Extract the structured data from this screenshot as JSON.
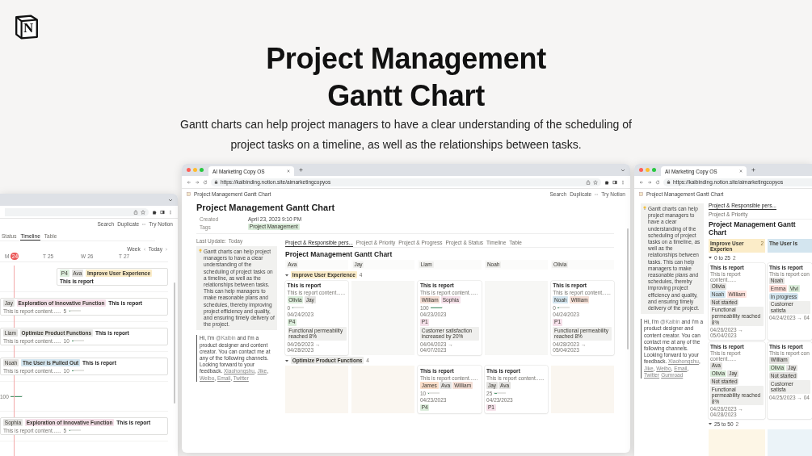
{
  "logo": "N",
  "title": "Project Management Gantt Chart",
  "description": "Gantt charts can help project managers to have a clear understanding of the scheduling of project tasks on a timeline, as well as the relationships between tasks.",
  "main_window": {
    "tab_title": "AI Marketing Copy OS",
    "url": "https://kaibinding.notion.site/aimarketingcopyos",
    "breadcrumb": "Project Management Gantt Chart",
    "actions": [
      "Search",
      "Duplicate",
      "Try Notion"
    ],
    "page_title": "Project Management Gantt Chart",
    "properties": [
      {
        "kind": "text",
        "label": "Created",
        "value": "April 23, 2023 9:10 PM"
      },
      {
        "kind": "tag",
        "label": "Tags",
        "value": "Project Management"
      }
    ],
    "last_update": {
      "label": "Last Update:",
      "value": "Today"
    },
    "callout": "Gantt charts can help project managers to have a clear understanding of the scheduling of project tasks on a timeline, as well as the relationships between tasks. This can help managers to make reasonable plans and schedules, thereby improving project efficiency and quality, and ensuring timely delivery of the project.",
    "quote": {
      "before": "Hi, I'm ",
      "mention": "@Kaibin",
      "after": " and I'm a product designer and content creator. You can contact me at any of the following channels. Looking forward to your feedback.",
      "channels": [
        {
          "name": "Xiaohongshu",
          "sep": ", "
        },
        {
          "name": "Jike",
          "sep": ", "
        },
        {
          "name": "Weibo",
          "sep": ", "
        },
        {
          "name": "Email",
          "sep": ", "
        },
        {
          "name": "Twitter"
        }
      ]
    },
    "views": [
      {
        "label": "Project & Responsible pers...",
        "selected": true
      },
      {
        "label": "Project & Priority",
        "selected": false
      },
      {
        "label": "Project & Progress",
        "selected": false
      },
      {
        "label": "Project & Status",
        "selected": false
      },
      {
        "label": "Timeline",
        "selected": false
      },
      {
        "label": "Table",
        "selected": false
      }
    ],
    "board_title": "Project Management Gantt Chart",
    "columns": [
      "Ava",
      "Jay",
      "Liam",
      "Noah",
      "Olivia"
    ],
    "groups": [
      {
        "name": "Improve User Experience",
        "count": "4",
        "color": "#fbecc8",
        "cards": [
          {
            "kind": "card",
            "title": "This is report",
            "content": "This is report content......",
            "people": [
              {
                "name": "Olivia",
                "color": "#dbeddb"
              },
              {
                "name": "Jay",
                "color": "#e3e2e0"
              }
            ],
            "progress": "0",
            "level": 0,
            "date": "04/24/2023",
            "priority": {
              "label": "P4",
              "color": "#dbeddb"
            },
            "goal": "Functional permeability reached 8%",
            "range": "04/26/2023 → 04/28/2023"
          },
          {
            "kind": "empty"
          },
          {
            "kind": "card",
            "title": "This is report",
            "content": "This is report content......",
            "people": [
              {
                "name": "William",
                "color": "#f4dfd6"
              },
              {
                "name": "Sophia",
                "color": "#f5e0e9"
              }
            ],
            "progress": "100",
            "level": 1,
            "date": "04/23/2023",
            "priority": {
              "label": "P1",
              "color": "#f5e0e9"
            },
            "goal": "Customer satisfaction increased by 20%",
            "range": "04/04/2023 → 04/07/2023"
          },
          {
            "kind": "empty"
          },
          {
            "kind": "card",
            "title": "This is report",
            "content": "This is report content......",
            "people": [
              {
                "name": "Noah",
                "color": "#d3e5ef"
              },
              {
                "name": "William",
                "color": "#f4dfd6"
              }
            ],
            "progress": "0",
            "level": 0,
            "date": "04/24/2023",
            "priority": {
              "label": "P1",
              "color": "#f5e0e9"
            },
            "goal": "Functional permeability reached 8%",
            "range": "04/28/2023 → 05/04/2023"
          }
        ]
      },
      {
        "name": "Optimize Product Functions",
        "count": "4",
        "color": "#e9e9e7",
        "cards": [
          {
            "kind": "empty"
          },
          {
            "kind": "empty"
          },
          {
            "kind": "card",
            "title": "This is report",
            "content": "This is report content......",
            "people": [
              {
                "name": "James",
                "color": "#fadec9"
              },
              {
                "name": "Ava",
                "color": "#e3e2e0"
              },
              {
                "name": "William",
                "color": "#f4dfd6"
              }
            ],
            "progress": "10",
            "level": 0.1,
            "date": "04/23/2023",
            "priority": {
              "label": "P4",
              "color": "#dbeddb"
            }
          },
          {
            "kind": "card",
            "title": "This is report",
            "content": "This is report content......",
            "people": [
              {
                "name": "Jay",
                "color": "#e3e2e0"
              },
              {
                "name": "Ava",
                "color": "#e3e2e0"
              }
            ],
            "progress": "25",
            "level": 0.25,
            "date": "04/23/2023",
            "priority": {
              "label": "P1",
              "color": "#f5e0e9"
            }
          },
          {
            "kind": "empty"
          }
        ]
      }
    ]
  },
  "timeline_window": {
    "actions": [
      "Search",
      "Duplicate",
      "Try Notion"
    ],
    "views": [
      {
        "label": "Status",
        "selected": false
      },
      {
        "label": "Timeline",
        "selected": true
      },
      {
        "label": "Table",
        "selected": false
      }
    ],
    "scale": "Week",
    "today": "Today",
    "days": [
      {
        "weekday": "M",
        "day": "24",
        "today": true
      },
      {
        "weekday": "T",
        "day": "25",
        "today": false
      },
      {
        "weekday": "W",
        "day": "26",
        "today": false
      },
      {
        "weekday": "T",
        "day": "27",
        "today": false
      }
    ],
    "rows": [
      {
        "kind": "bar",
        "tags": [
          {
            "name": "P4",
            "color": "#dbeddb"
          },
          {
            "name": "Ava",
            "color": "#e3e2e0"
          }
        ],
        "project": {
          "name": "Improve User Experience",
          "color": "#fbecc8"
        },
        "title": "This is report"
      },
      {
        "kind": "bar",
        "tags": [
          {
            "name": "Jay",
            "color": "#e3e2e0"
          }
        ],
        "project": {
          "name": "Exploration of Innovative Function",
          "color": "#f5e0e9"
        },
        "title": "This is report",
        "content": "This is report content......",
        "progress": "5",
        "level": 0.05
      },
      {
        "kind": "bar",
        "tags": [
          {
            "name": "Liam",
            "color": "#e3e2e0"
          }
        ],
        "project": {
          "name": "Optimize Product Functions",
          "color": "#e9e9e7"
        },
        "title": "This is report",
        "content": "This is report content......",
        "progress": "10",
        "level": 0.1
      },
      {
        "kind": "bar",
        "tags": [
          {
            "name": "Noah",
            "color": "#e3e2e0"
          }
        ],
        "project": {
          "name": "The User is Pulled Out",
          "color": "#d3e5ef"
        },
        "title": "This is report",
        "content": "This is report content......",
        "progress": "10",
        "level": 0.1
      },
      {
        "kind": "progress",
        "progress": "100",
        "level": 1
      },
      {
        "kind": "bar",
        "tags": [
          {
            "name": "Sophia",
            "color": "#e3e2e0"
          }
        ],
        "project": {
          "name": "Exploration of Innovative Function",
          "color": "#f5e0e9"
        },
        "title": "This is report",
        "content": "This is report content......",
        "progress": "5",
        "level": 0.05
      }
    ]
  },
  "board_window": {
    "tab_title": "AI Marketing Copy OS",
    "url": "https://kaibinding.notion.site/aimarketingcopyos",
    "breadcrumb": "Project Management Gantt Chart",
    "callout": "Gantt charts can help project managers to have a clear understanding of the scheduling of project tasks on a timeline, as well as the relationships between tasks. This can help managers to make reasonable plans and schedules, thereby improving project efficiency and quality, and ensuring timely delivery of the project.",
    "quote": {
      "before": "Hi, I'm ",
      "mention": "@Kaibin",
      "after": " and I'm a product designer and content creator. You can contact me at any of the following channels. Looking forward to your feedback.",
      "channels": [
        {
          "name": "Xiaohongshu",
          "sep": ", "
        },
        {
          "name": "Jike",
          "sep": ", "
        },
        {
          "name": "Weibo",
          "sep": ", "
        },
        {
          "name": "Email",
          "sep": ", "
        },
        {
          "name": "Twitter"
        },
        {
          "name": "Gumroad"
        }
      ]
    },
    "views": [
      {
        "label": "Project & Responsible pers...",
        "selected": true
      },
      {
        "label": "Project & Priority",
        "selected": false
      }
    ],
    "board_title": "Project Management Gantt Chart",
    "columns": [
      {
        "name": "Improve User Experien",
        "count": "2",
        "color": "#fbecc8"
      },
      {
        "name": "The User Is",
        "color": "#d3e5ef"
      }
    ],
    "subgroups": [
      {
        "name": "0 to 25",
        "count": "2",
        "rows": [
          [
            {
              "title": "This is report",
              "content": "This is report content......",
              "owner": {
                "name": "Olivia",
                "color": "#e3e2e0"
              },
              "people": [
                {
                  "name": "Noah",
                  "color": "#d3e5ef"
                },
                {
                  "name": "William",
                  "color": "#ffe2dd"
                }
              ],
              "status": {
                "label": "Not started",
                "color": "#e3e2e0"
              },
              "goal": "Functional permeability reached 8%",
              "range": "04/26/2023 → 05/04/2023"
            },
            {
              "title": "This is report",
              "content": "This is report con",
              "owner": {
                "name": "Noah",
                "color": "#e3e2e0"
              },
              "people": [
                {
                  "name": "Emma",
                  "color": "#ffe2dd"
                },
                {
                  "name": "Vivi",
                  "color": "#dbeddb"
                }
              ],
              "status": {
                "label": "In progress",
                "color": "#d3e5ef"
              },
              "goal": "Customer satisfa",
              "range": "04/24/2023 → 04"
            }
          ],
          [
            {
              "title": "This is report",
              "content": "This is report content......",
              "owner": {
                "name": "Ava",
                "color": "#e3e2e0"
              },
              "people": [
                {
                  "name": "Olivia",
                  "color": "#dbeddb"
                },
                {
                  "name": "Jay",
                  "color": "#e3e2e0"
                }
              ],
              "status": {
                "label": "Not started",
                "color": "#e3e2e0"
              },
              "goal": "Functional permeability reached 8%",
              "range": "04/26/2023 → 04/28/2023"
            },
            {
              "title": "This is report",
              "content": "This is report con",
              "owner": {
                "name": "William",
                "color": "#e3e2e0"
              },
              "people": [
                {
                  "name": "Olivia",
                  "color": "#dbeddb"
                },
                {
                  "name": "Jay",
                  "color": "#e3e2e0"
                }
              ],
              "status": {
                "label": "Not started",
                "color": "#e3e2e0"
              },
              "goal": "Customer satisfa",
              "range": "04/25/2023 → 04"
            }
          ]
        ]
      },
      {
        "name": "25 to 50",
        "count": "2"
      }
    ]
  }
}
